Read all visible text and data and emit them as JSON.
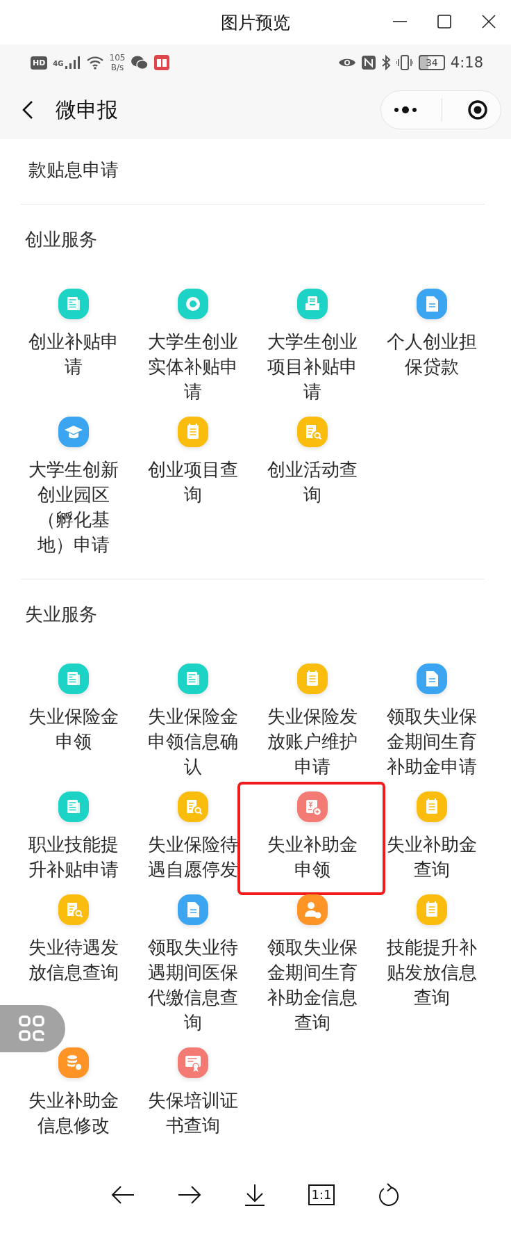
{
  "window": {
    "title": "图片预览"
  },
  "status_bar": {
    "hd": "HD",
    "network": "4G",
    "speed": "105",
    "speed_unit": "B/s",
    "battery": "34",
    "time": "4:18"
  },
  "nav": {
    "title": "微申报"
  },
  "partial_item": {
    "label": "款贴息申请"
  },
  "sections": [
    {
      "title": "创业服务",
      "items": [
        {
          "label": "创业补贴申请",
          "kind": "news",
          "color": "#1dd3c5",
          "highlighted": false
        },
        {
          "label": "大学生创业实体补贴申请",
          "kind": "ring",
          "color": "#1dd3c5",
          "highlighted": false
        },
        {
          "label": "大学生创业项目补贴申请",
          "kind": "tray",
          "color": "#1dd3c5",
          "highlighted": false
        },
        {
          "label": "个人创业担保贷款",
          "kind": "file",
          "color": "#3ba5f2",
          "highlighted": false
        },
        {
          "label": "大学生创新创业园区（孵化基地）申请",
          "kind": "cap",
          "color": "#3ba5f2",
          "highlighted": false
        },
        {
          "label": "创业项目查询",
          "kind": "note",
          "color": "#fbbd0d",
          "highlighted": false
        },
        {
          "label": "创业活动查询",
          "kind": "search",
          "color": "#fbbd0d",
          "highlighted": false
        }
      ]
    },
    {
      "title": "失业服务",
      "items": [
        {
          "label": "失业保险金申领",
          "kind": "news",
          "color": "#1dd3c5",
          "highlighted": false
        },
        {
          "label": "失业保险金申领信息确认",
          "kind": "news",
          "color": "#1dd3c5",
          "highlighted": false
        },
        {
          "label": "失业保险发放账户维护申请",
          "kind": "note",
          "color": "#fbbd0d",
          "highlighted": false
        },
        {
          "label": "领取失业保金期间生育补助金申请",
          "kind": "file",
          "color": "#3ba5f2",
          "highlighted": false
        },
        {
          "label": "职业技能提升补贴申请",
          "kind": "news",
          "color": "#1dd3c5",
          "highlighted": false
        },
        {
          "label": "失业保险待遇自愿停发",
          "kind": "search",
          "color": "#fbbd0d",
          "highlighted": false
        },
        {
          "label": "失业补助金申领",
          "kind": "yen",
          "color": "#f47a74",
          "highlighted": true
        },
        {
          "label": "失业补助金查询",
          "kind": "note",
          "color": "#fbbd0d",
          "highlighted": false
        },
        {
          "label": "失业待遇发放信息查询",
          "kind": "search",
          "color": "#fbbd0d",
          "highlighted": false
        },
        {
          "label": "领取失业待遇期间医保代缴信息查询",
          "kind": "file",
          "color": "#3ba5f2",
          "highlighted": false
        },
        {
          "label": "领取失业保金期间生育补助金信息查询",
          "kind": "person",
          "color": "#ff9426",
          "highlighted": false
        },
        {
          "label": "技能提升补贴发放信息查询",
          "kind": "note",
          "color": "#fbbd0d",
          "highlighted": false
        },
        {
          "label": "失业补助金信息修改",
          "kind": "coins",
          "color": "#ff9426",
          "highlighted": false
        },
        {
          "label": "失保培训证书查询",
          "kind": "cert",
          "color": "#f47a74",
          "highlighted": false
        }
      ]
    }
  ],
  "toolbar": [
    {
      "kind": "prev"
    },
    {
      "kind": "next"
    },
    {
      "kind": "download"
    },
    {
      "kind": "actual-size",
      "label": "1:1"
    },
    {
      "kind": "rotate"
    }
  ]
}
